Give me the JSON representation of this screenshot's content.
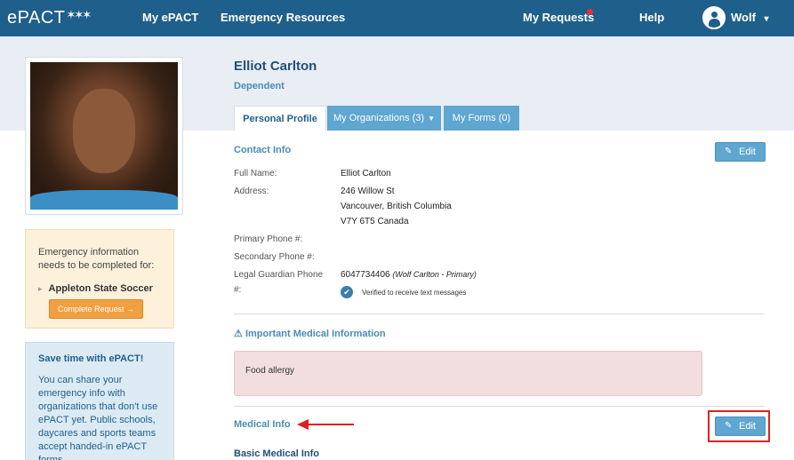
{
  "nav": {
    "logo": "ePACT",
    "my_epact": "My ePACT",
    "emergency_resources": "Emergency Resources",
    "my_requests": "My Requests",
    "help": "Help",
    "user_name": "Wolf",
    "user_caret": "▾",
    "colors": {
      "bar": "#1f5f8b",
      "notification": "#e8303a"
    }
  },
  "profile": {
    "name": "Elliot Carlton",
    "role": "Dependent"
  },
  "tabs": [
    {
      "label": "Personal Profile",
      "active": true
    },
    {
      "label": "My Organizations (3)",
      "active": false,
      "has_dropdown": true
    },
    {
      "label": "My Forms (0)",
      "active": false
    }
  ],
  "emergency_box": {
    "message": "Emergency information needs to be completed for:",
    "organization": "Appleton State Soccer",
    "button": "Complete Request →"
  },
  "save_box": {
    "title": "Save time with ePACT!",
    "body": "You can share your emergency info with organizations that don't use ePACT yet. Public schools, daycares and sports teams accept handed-in ePACT forms."
  },
  "contact_info": {
    "title": "Contact Info",
    "edit_label": "Edit",
    "fields": {
      "full_name_label": "Full Name:",
      "full_name": "Elliot Carlton",
      "address_label": "Address:",
      "address_line1": "246 Willow St",
      "address_line2": "Vancouver, British Columbia",
      "address_line3": "V7Y 6T5 Canada",
      "primary_phone_label": "Primary Phone #:",
      "secondary_phone_label": "Secondary Phone #:",
      "guardian_phone_label_1": "Legal Guardian Phone",
      "guardian_phone_label_2": "#:",
      "guardian_phone": "6047734406",
      "guardian_phone_note": "(Wolf Carlton - Primary)",
      "verified_text": "Verified to receive text messages"
    }
  },
  "important_medical": {
    "title": "Important Medical Information",
    "alert": "Food allergy"
  },
  "medical_info": {
    "title": "Medical Info",
    "edit_label": "Edit",
    "subtitle": "Basic Medical Info"
  }
}
